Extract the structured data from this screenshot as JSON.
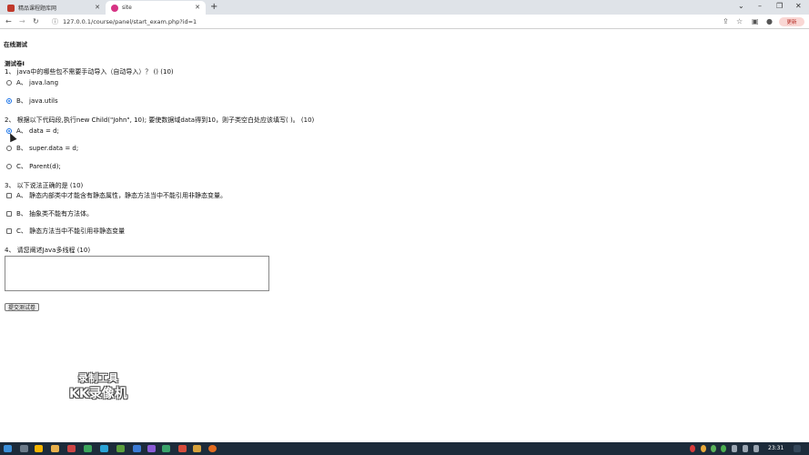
{
  "browser": {
    "tabs": [
      {
        "title": "精品课程题库网"
      },
      {
        "title": "site"
      }
    ],
    "address": "127.0.0.1/course/panel/start_exam.php?id=1",
    "update_label": "更新"
  },
  "page": {
    "heading": "在线测试",
    "paper_title": "测试卷I",
    "questions": [
      {
        "text": "1、 java中的哪些包不需要手动导入（自动导入）？ ()    (10)",
        "options": [
          "A、  java.lang",
          "B、  java.utils"
        ]
      },
      {
        "text": "2、 根据以下代码段,执行new Child(\"John\", 10); 要使数据域data得到10，则子类空白处应该填写( )。  (10)",
        "options": [
          "A、  data = d;",
          "B、  super.data = d;",
          "C、  Parent(d);"
        ]
      },
      {
        "text": "3、 以下说法正确的是   (10)",
        "options": [
          "A、  静态内部类中才能含有静态属性，静态方法当中不能引用非静态变量。",
          "B、  抽象类不能有方法体。",
          "C、  静态方法当中不能引用非静态变量"
        ]
      },
      {
        "text": "4、 请您阐述Java多线程   (10)"
      }
    ],
    "answer_value": "",
    "submit_label": "提交测试卷"
  },
  "watermark": {
    "line1": "录制工具",
    "line2": "KK录像机"
  },
  "taskbar": {
    "clock": "23:31"
  }
}
